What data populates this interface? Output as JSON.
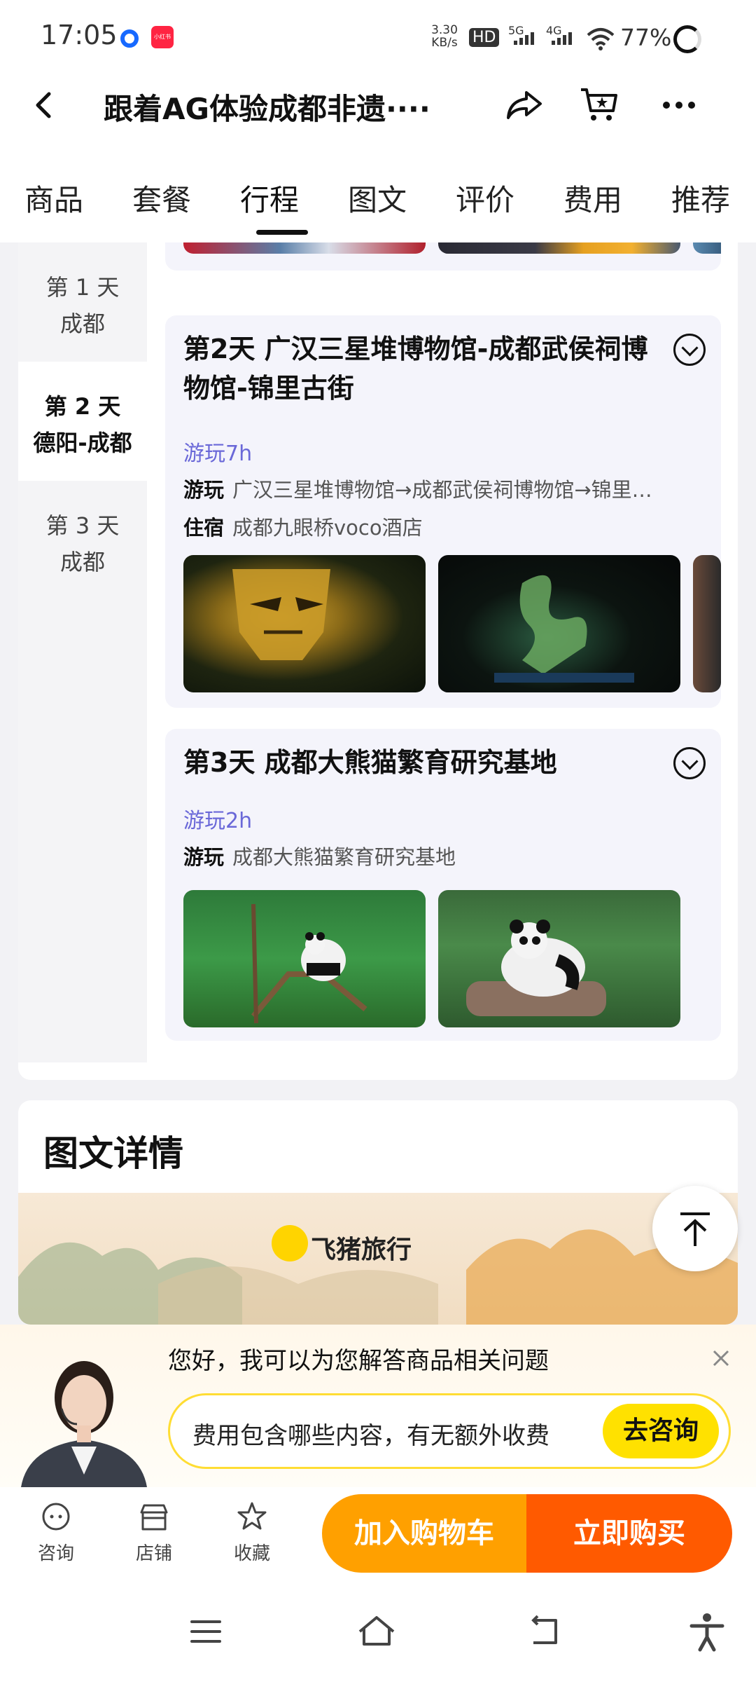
{
  "status_bar": {
    "time": "17:05",
    "app_badge": "小红书",
    "net_speed_top": "3.30",
    "net_speed_unit": "KB/s",
    "hd": "HD",
    "sim1": "5G",
    "sim2": "4G",
    "battery": "77%"
  },
  "titlebar": {
    "title": "跟着AG体验成都非遗····"
  },
  "tabs": [
    "商品",
    "套餐",
    "行程",
    "图文",
    "评价",
    "费用",
    "推荐"
  ],
  "active_tab_index": 2,
  "day_nav": [
    {
      "label": "第 1 天",
      "place": "成都"
    },
    {
      "label": "第 2 天",
      "place": "德阳-成都"
    },
    {
      "label": "第 3 天",
      "place": "成都"
    }
  ],
  "days": [
    {
      "title": "第2天   广汉三星堆博物馆-成都武侯祠博物馆-锦里古街",
      "duration": "游玩7h",
      "play_label": "游玩",
      "play_value": "广汉三星堆博物馆→成都武侯祠博物馆→锦里…",
      "stay_label": "住宿",
      "stay_value": "成都九眼桥voco酒店"
    },
    {
      "title": "第3天   成都大熊猫繁育研究基地",
      "duration": "游玩2h",
      "play_label": "游玩",
      "play_value": "成都大熊猫繁育研究基地"
    }
  ],
  "details": {
    "title": "图文详情",
    "brand": "飞猪旅行"
  },
  "assistant": {
    "greeting": "您好，我可以为您解答商品相关问题",
    "question": "费用包含哪些内容，有无额外收费",
    "ask_button": "去咨询"
  },
  "bottom_actions": {
    "consult": "咨询",
    "store": "店铺",
    "favorite": "收藏",
    "add_cart": "加入购物车",
    "buy_now": "立即购买"
  },
  "colors": {
    "accent_purple": "#6a68d8",
    "cart_orange": "#ffa000",
    "buy_orange": "#ff5a00",
    "ask_yellow": "#ffe100"
  }
}
